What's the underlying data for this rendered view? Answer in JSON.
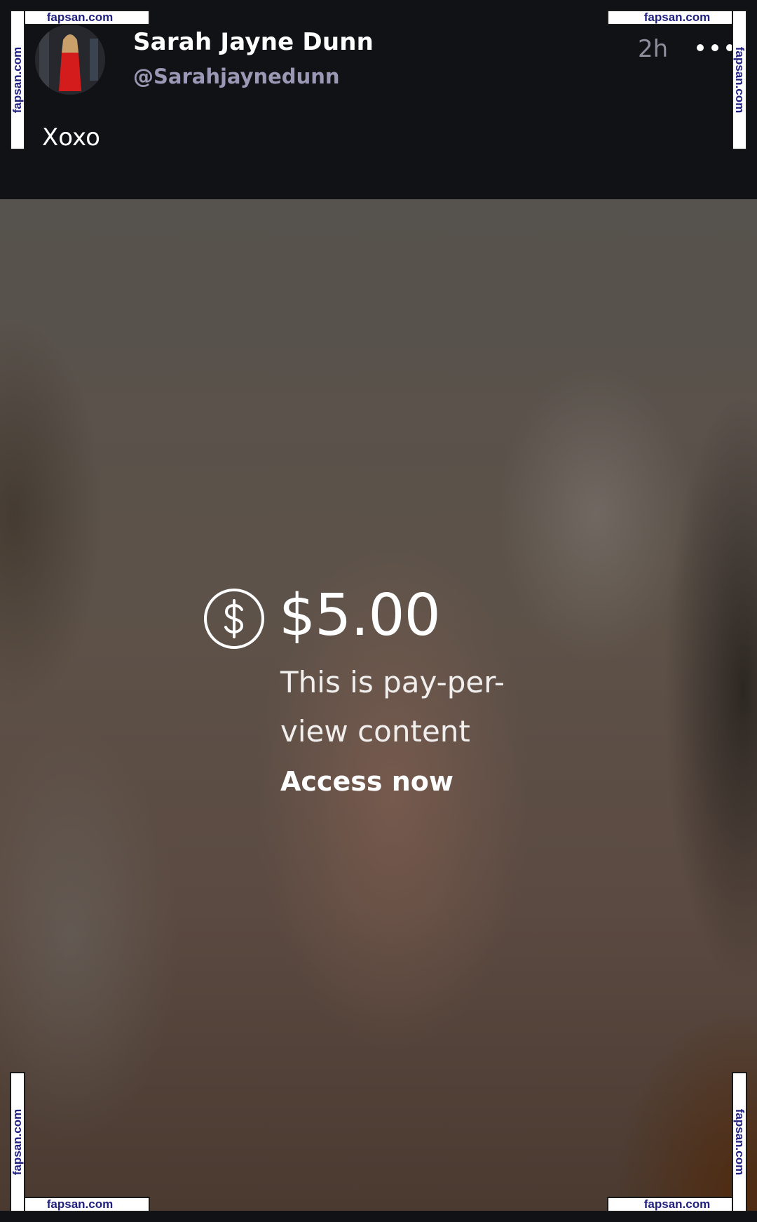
{
  "post": {
    "author_name": "Sarah Jayne Dunn",
    "author_handle": "@Sarahjaynedunn",
    "timestamp": "2h",
    "caption": "Xoxo"
  },
  "paywall": {
    "price": "$5.00",
    "description": "This is pay-per-view content",
    "access_label": "Access now",
    "icon": "dollar-circle-icon"
  },
  "watermark": {
    "text": "fapsan.com"
  },
  "colors": {
    "background": "#111216",
    "handle": "#9a98b4",
    "timestamp": "#8f8d9c",
    "watermark_text": "#202080"
  }
}
